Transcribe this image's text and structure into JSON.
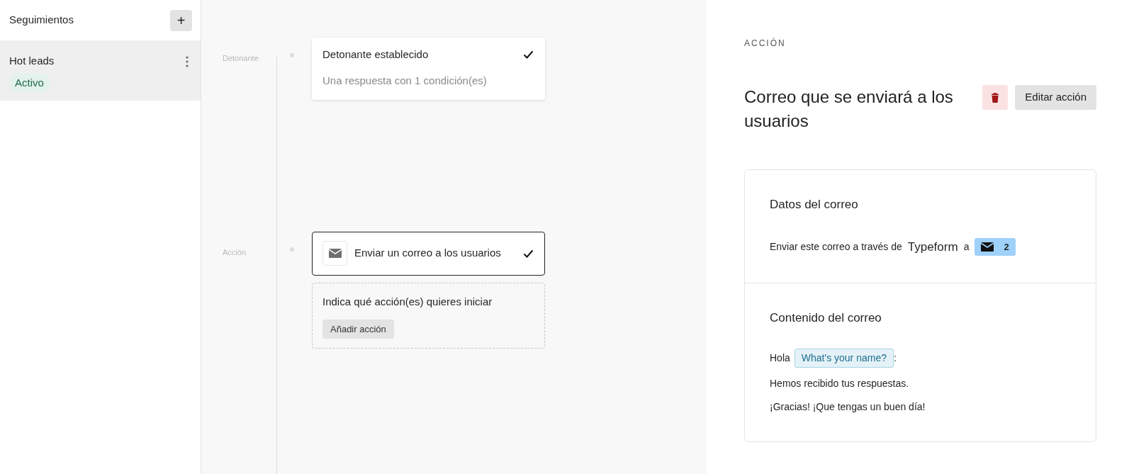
{
  "sidebar": {
    "title": "Seguimientos",
    "add_button": "+",
    "items": [
      {
        "name": "Hot leads",
        "status": "Activo",
        "selected": true
      }
    ]
  },
  "timeline": {
    "steps": [
      {
        "kind": "trigger",
        "label": "Detonante",
        "title": "Detonante establecido",
        "subtitle": "Una respuesta con 1 condición(es)",
        "checked": true
      },
      {
        "kind": "email",
        "label": "Acción",
        "title": "Enviar un correo a los usuarios",
        "checked": true
      }
    ],
    "add_action": {
      "prompt": "Indica qué acción(es) quieres iniciar",
      "button": "Añadir acción"
    }
  },
  "panel": {
    "section_label": "ACCIÓN",
    "title": "Correo que se enviará a los usuarios",
    "edit_button": "Editar acción",
    "details": {
      "heading": "Datos del correo",
      "text": "Enviar este correo a través de",
      "sender": "Typeform",
      "connector": "a",
      "recipients": "2"
    },
    "content": {
      "heading": "Contenido del correo",
      "lines": [
        {
          "kind": "greeting",
          "text": "Hola",
          "field": "What's your name?",
          "suffix": ":"
        },
        {
          "kind": "text",
          "text": "Hemos recibido tus respuestas."
        },
        {
          "kind": "text",
          "text": "¡Gracias! ¡Que tengas un buen día!"
        }
      ]
    }
  }
}
